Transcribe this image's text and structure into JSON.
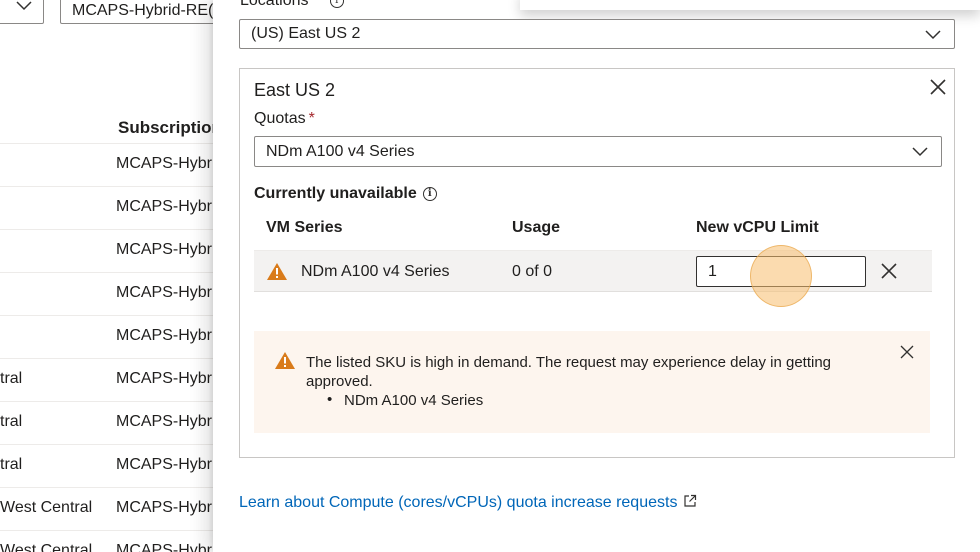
{
  "background": {
    "filter_value": "MCAPS-Hybrid-RE(",
    "column_header": "Subscription",
    "rows": [
      {
        "region": "",
        "subscription": "MCAPS-Hybr"
      },
      {
        "region": "",
        "subscription": "MCAPS-Hybr"
      },
      {
        "region": "",
        "subscription": "MCAPS-Hybr"
      },
      {
        "region": "",
        "subscription": "MCAPS-Hybr"
      },
      {
        "region": "",
        "subscription": "MCAPS-Hybr"
      },
      {
        "region": "tral",
        "subscription": "MCAPS-Hybr"
      },
      {
        "region": "tral",
        "subscription": "MCAPS-Hybr"
      },
      {
        "region": "tral",
        "subscription": "MCAPS-Hybr"
      },
      {
        "region": "West Central",
        "subscription": "MCAPS-Hybr"
      },
      {
        "region": "West Central",
        "subscription": "MCAPS-Hybr"
      }
    ]
  },
  "panel": {
    "locations_label": "Locations",
    "required_mark": "*",
    "info_glyph": "i",
    "location_value": "(US) East US 2",
    "region_card": {
      "title": "East US 2",
      "quotas_label": "Quotas",
      "quota_value": "NDm A100 v4 Series",
      "unavailable_label": "Currently unavailable",
      "table": {
        "headers": {
          "series": "VM Series",
          "usage": "Usage",
          "limit": "New vCPU Limit"
        },
        "row": {
          "series": "NDm A100 v4 Series",
          "usage": "0 of 0",
          "limit_value": "1"
        }
      },
      "warning": {
        "message": "The listed SKU is high in demand. The request may experience delay in getting approved.",
        "items": [
          "NDm A100 v4 Series"
        ]
      }
    },
    "learn_link": "Learn about Compute (cores/vCPUs) quota increase requests"
  },
  "colors": {
    "link": "#0066b8",
    "warning_icon": "#d97b1a",
    "warning_bg": "#fdf5ee",
    "required": "#a4262c",
    "click_marker": "#f8be6e"
  },
  "icons": [
    "chevron-down-icon",
    "info-icon",
    "close-icon",
    "warning-icon",
    "external-link-icon"
  ]
}
